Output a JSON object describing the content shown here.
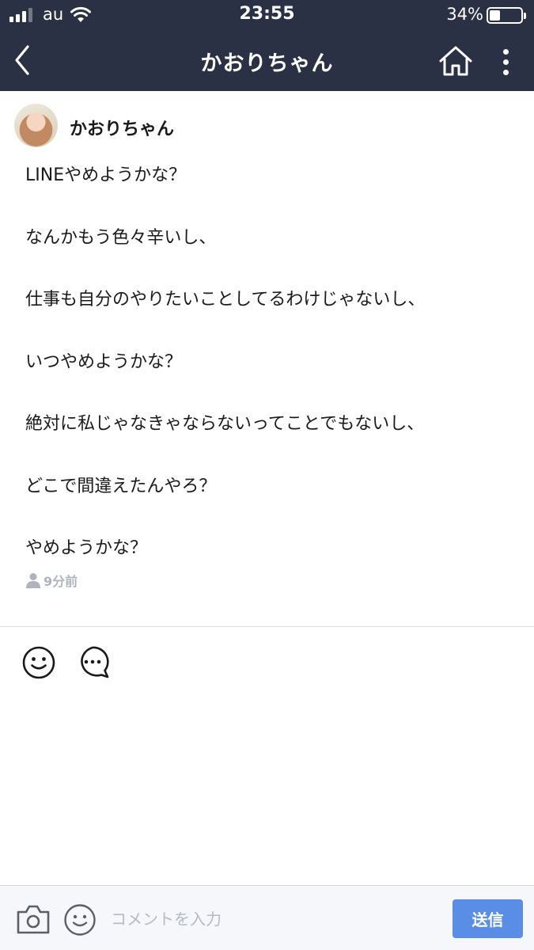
{
  "status_bar": {
    "carrier": "au",
    "time": "23:55",
    "battery_percent": "34%",
    "battery_level": 0.34,
    "signal_bars": 4,
    "signal_bars_active": 3
  },
  "nav": {
    "title": "かおりちゃん",
    "back_icon": "chevron-left-icon",
    "home_icon": "home-icon",
    "more_icon": "more-vertical-icon"
  },
  "post": {
    "author": "かおりちゃん",
    "lines": [
      "LINEやめようかな？",
      "なんかもう色々辛いし、",
      "仕事も自分のやりたいことしてるわけじゃないし、",
      "いつやめようかな？",
      "絶対に私じゃなきゃならないってことでもないし、",
      "どこで間違えたんやろ？",
      "やめようかな？"
    ],
    "time_ago": "9分前"
  },
  "reactions": {
    "like_icon": "smiley-icon",
    "comment_icon": "speech-bubble-icon"
  },
  "comment_bar": {
    "placeholder": "コメントを入力",
    "send_label": "送信"
  },
  "colors": {
    "header_bg": "#2a3144",
    "send_button": "#5a8ee6",
    "muted_text": "#aeb3bd"
  }
}
